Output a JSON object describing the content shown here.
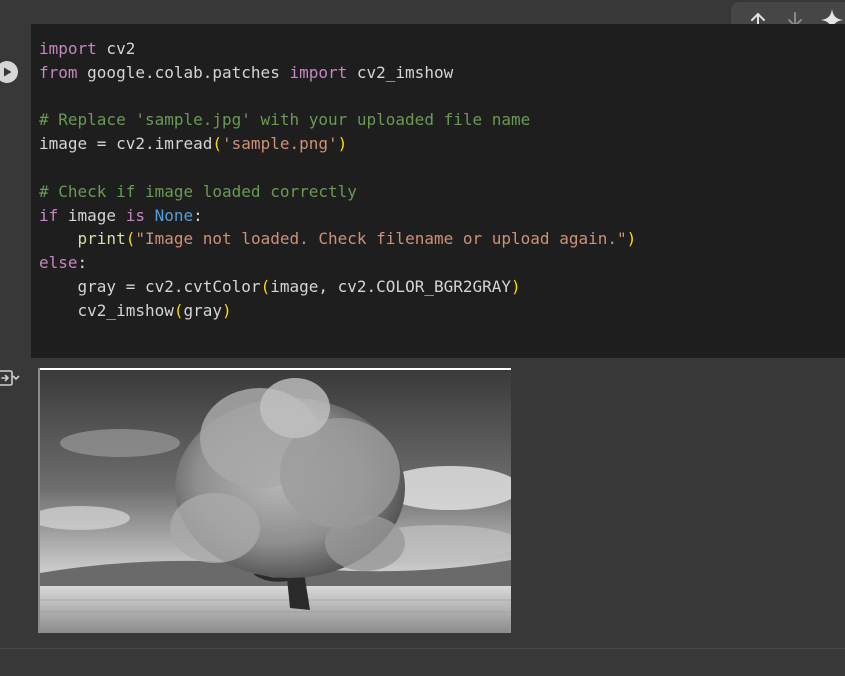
{
  "code": {
    "lines": [
      [
        {
          "t": "import",
          "c": "kw"
        },
        {
          "t": " cv2",
          "c": ""
        }
      ],
      [
        {
          "t": "from",
          "c": "kw"
        },
        {
          "t": " google.colab.patches ",
          "c": ""
        },
        {
          "t": "import",
          "c": "kw"
        },
        {
          "t": " cv2_imshow",
          "c": ""
        }
      ],
      [],
      [
        {
          "t": "# Replace 'sample.jpg' with your uploaded file name",
          "c": "cm"
        }
      ],
      [
        {
          "t": "image = cv2.imread",
          "c": ""
        },
        {
          "t": "(",
          "c": "p1"
        },
        {
          "t": "'sample.png'",
          "c": "st"
        },
        {
          "t": ")",
          "c": "p1"
        }
      ],
      [],
      [
        {
          "t": "# Check if image loaded correctly",
          "c": "cm"
        }
      ],
      [
        {
          "t": "if",
          "c": "kw"
        },
        {
          "t": " image ",
          "c": ""
        },
        {
          "t": "is",
          "c": "kw"
        },
        {
          "t": " ",
          "c": ""
        },
        {
          "t": "None",
          "c": "bl"
        },
        {
          "t": ":",
          "c": ""
        }
      ],
      [
        {
          "t": "    ",
          "c": ""
        },
        {
          "t": "print",
          "c": "fn"
        },
        {
          "t": "(",
          "c": "p1"
        },
        {
          "t": "\"Image not loaded. Check filename or upload again.\"",
          "c": "st"
        },
        {
          "t": ")",
          "c": "p1"
        }
      ],
      [
        {
          "t": "else",
          "c": "kw"
        },
        {
          "t": ":",
          "c": ""
        }
      ],
      [
        {
          "t": "    gray = cv2.cvtColor",
          "c": ""
        },
        {
          "t": "(",
          "c": "p1"
        },
        {
          "t": "image, cv2.COLOR_BGR2GRAY",
          "c": ""
        },
        {
          "t": ")",
          "c": "p1"
        }
      ],
      [
        {
          "t": "    cv2_imshow",
          "c": ""
        },
        {
          "t": "(",
          "c": "p1"
        },
        {
          "t": "gray",
          "c": ""
        },
        {
          "t": ")",
          "c": "p1"
        }
      ]
    ]
  },
  "toolbar": {
    "icons": [
      "arrow-up-icon",
      "arrow-down-icon",
      "gemini-sparkle-icon"
    ]
  },
  "output": {
    "image_description_icon": "grayscale-tree-image"
  }
}
